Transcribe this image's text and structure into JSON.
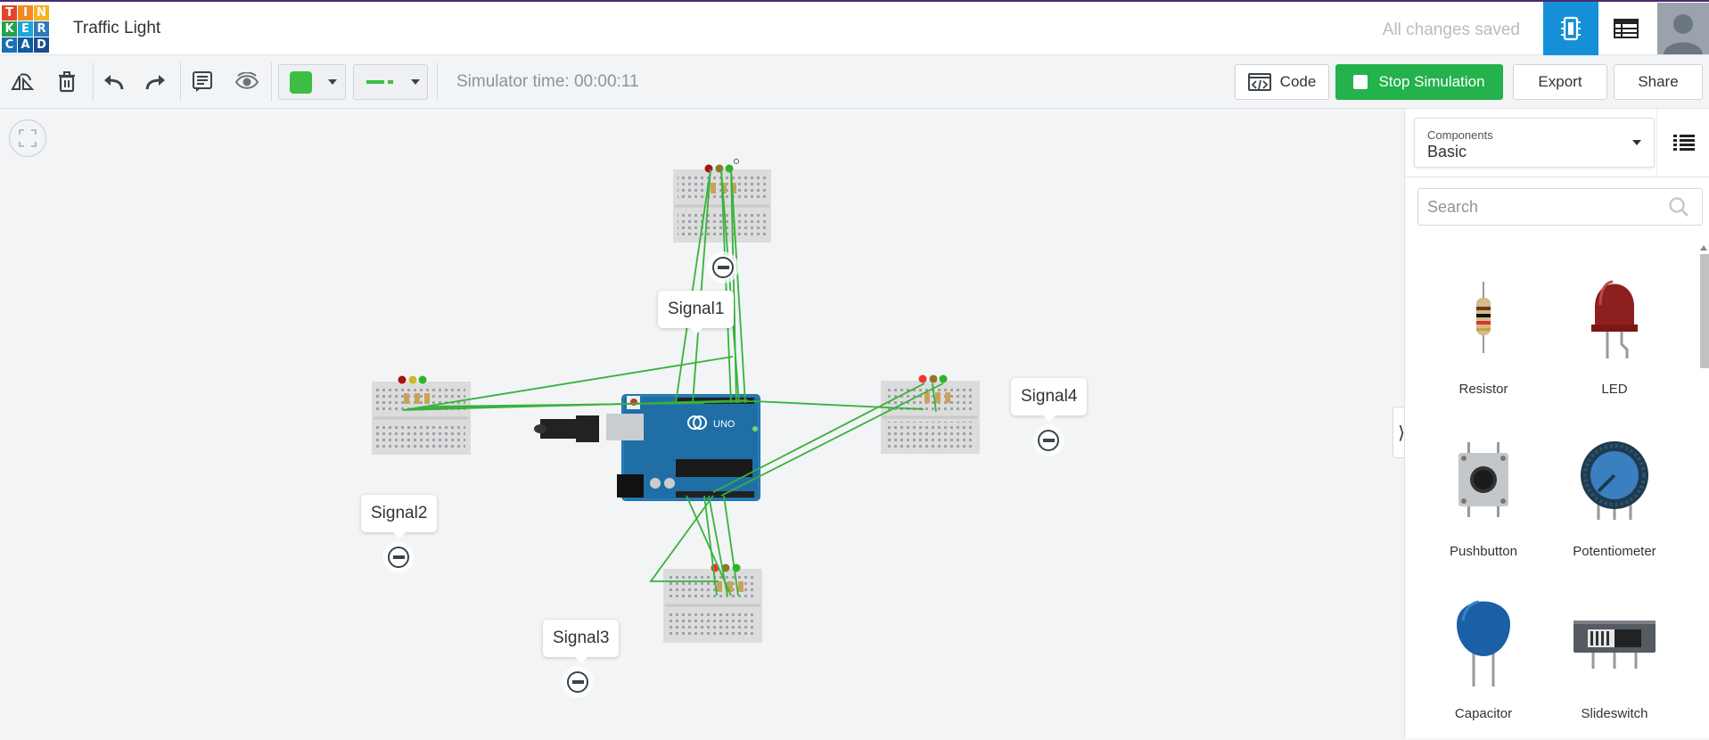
{
  "app": {
    "logo_letters": [
      "T",
      "I",
      "N",
      "K",
      "E",
      "R",
      "C",
      "A",
      "D"
    ],
    "logo_colors": [
      "#e2452c",
      "#f08a24",
      "#f8b21e",
      "#23a149",
      "#1ba6d9",
      "#2b7bbd",
      "#1b6fb7",
      "#0d5ba0",
      "#1a4d8f"
    ],
    "title": "Traffic Light",
    "save_status": "All changes saved"
  },
  "toolbar": {
    "simulator_time": "Simulator time: 00:00:11",
    "color_value": "#3cbe42",
    "code_label": "Code",
    "stop_label": "Stop Simulation",
    "export_label": "Export",
    "share_label": "Share"
  },
  "canvas": {
    "signals": [
      {
        "id": "signal1",
        "label": "Signal1"
      },
      {
        "id": "signal2",
        "label": "Signal2"
      },
      {
        "id": "signal3",
        "label": "Signal3"
      },
      {
        "id": "signal4",
        "label": "Signal4"
      }
    ],
    "arduino_label": "UNO",
    "wire_color": "#38b23b"
  },
  "panel": {
    "category_label": "Components",
    "category_value": "Basic",
    "search_placeholder": "Search",
    "components": [
      {
        "name": "Resistor",
        "icon": "resistor-icon"
      },
      {
        "name": "LED",
        "icon": "led-icon"
      },
      {
        "name": "Pushbutton",
        "icon": "pushbutton-icon"
      },
      {
        "name": "Potentiometer",
        "icon": "potentiometer-icon"
      },
      {
        "name": "Capacitor",
        "icon": "capacitor-icon"
      },
      {
        "name": "Slideswitch",
        "icon": "slideswitch-icon"
      }
    ]
  }
}
